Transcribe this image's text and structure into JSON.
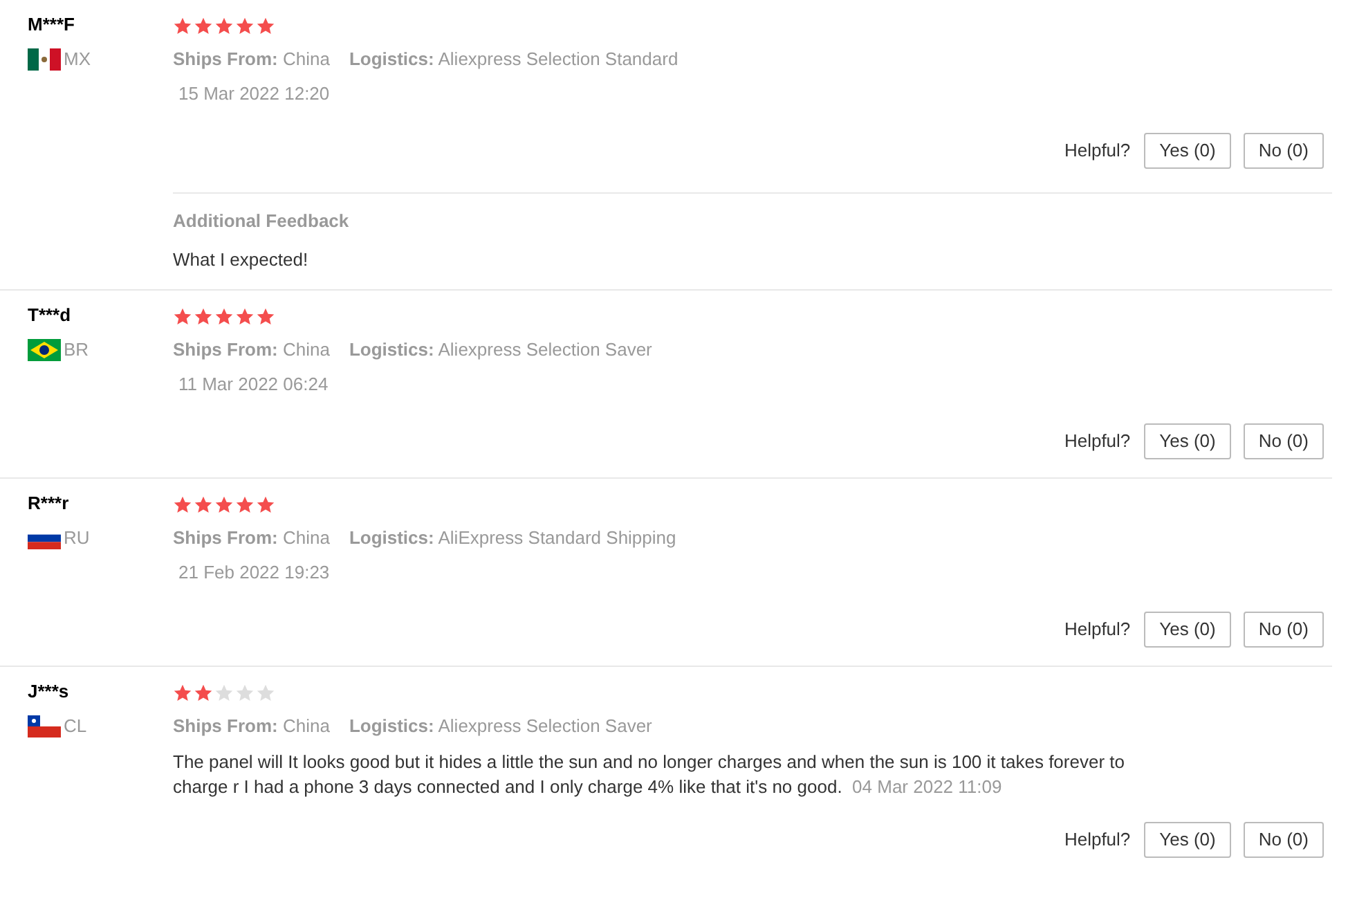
{
  "reviews": [
    {
      "name": "M***F",
      "flag": {
        "kind": "mexico"
      },
      "country": "MX",
      "stars": 5,
      "ships_label": "Ships From:",
      "ships_value": "China",
      "logistics_label": "Logistics:",
      "logistics_value": "Aliexpress Selection Standard",
      "date": "15 Mar 2022 12:20",
      "helpful_label": "Helpful?",
      "yes": "Yes (0)",
      "no": "No (0)",
      "additional": {
        "title": "Additional Feedback",
        "text": "What I expected!"
      }
    },
    {
      "name": "T***d",
      "flag": {
        "kind": "brazil"
      },
      "country": "BR",
      "stars": 5,
      "ships_label": "Ships From:",
      "ships_value": "China",
      "logistics_label": "Logistics:",
      "logistics_value": "Aliexpress Selection Saver",
      "date": "11 Mar 2022 06:24",
      "helpful_label": "Helpful?",
      "yes": "Yes (0)",
      "no": "No (0)"
    },
    {
      "name": "R***r",
      "flag": {
        "kind": "russia"
      },
      "country": "RU",
      "stars": 5,
      "ships_label": "Ships From:",
      "ships_value": "China",
      "logistics_label": "Logistics:",
      "logistics_value": "AliExpress Standard Shipping",
      "date": "21 Feb 2022 19:23",
      "helpful_label": "Helpful?",
      "yes": "Yes (0)",
      "no": "No (0)"
    },
    {
      "name": "J***s",
      "flag": {
        "kind": "chile"
      },
      "country": "CL",
      "stars": 2,
      "ships_label": "Ships From:",
      "ships_value": "China",
      "logistics_label": "Logistics:",
      "logistics_value": "Aliexpress Selection Saver",
      "text": "The panel will It looks good but it hides a little the sun and no longer charges and when the sun is 100 it takes forever to charge r I had a phone 3 days connected and I only charge 4% like that it's no good.",
      "date": "04 Mar 2022 11:09",
      "helpful_label": "Helpful?",
      "yes": "Yes (0)",
      "no": "No (0)"
    }
  ]
}
